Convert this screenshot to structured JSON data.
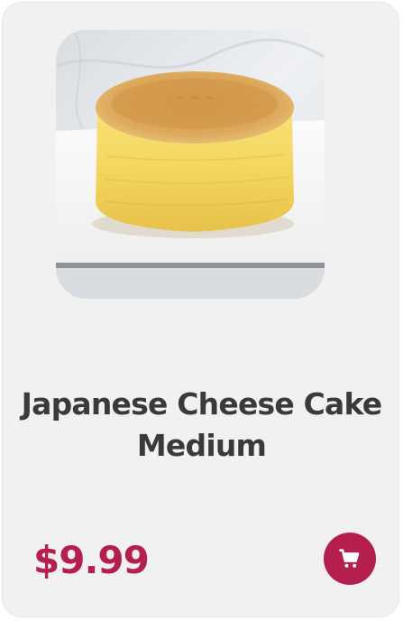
{
  "product": {
    "title": "Japanese Cheese Cake Medium",
    "price": "$9.99",
    "image_alt": "Japanese cheese cake on a white board",
    "cart_icon": "cart-icon"
  },
  "colors": {
    "card_background": "#f1f1f1",
    "price": "#b51f4e",
    "cart_button": "#b51f4e",
    "title": "#3a3a3a"
  }
}
